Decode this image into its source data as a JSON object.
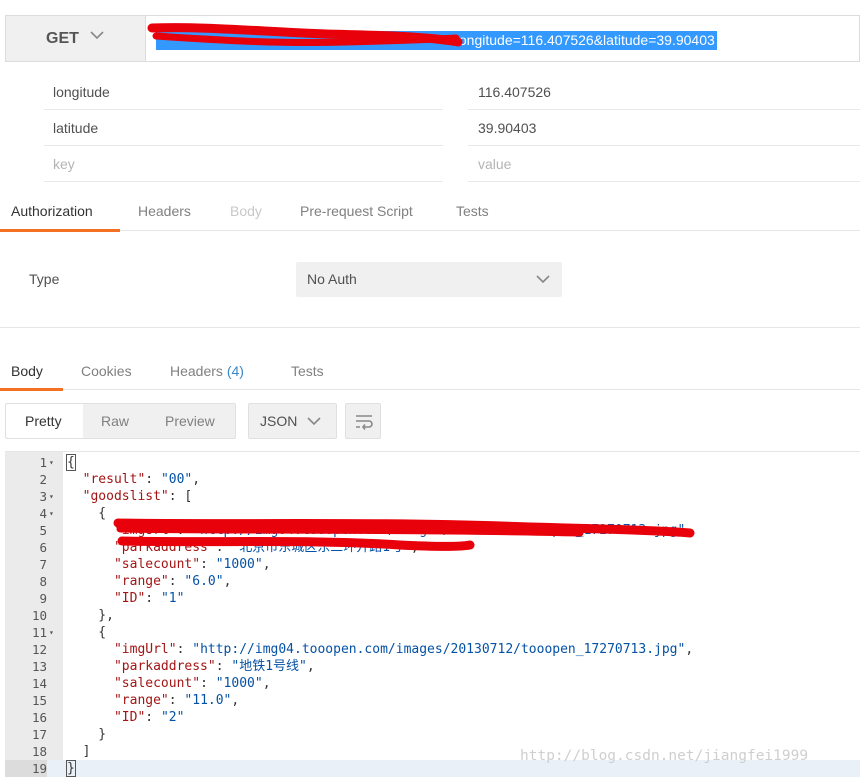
{
  "request": {
    "method": "GET",
    "url_visible_part": "?longitude=116.407526&latitude=39.90403"
  },
  "params": [
    {
      "key": "longitude",
      "value": "116.407526"
    },
    {
      "key": "latitude",
      "value": "39.90403"
    }
  ],
  "params_placeholder": {
    "key": "key",
    "value": "value"
  },
  "request_tabs": [
    "Authorization",
    "Headers",
    "Body",
    "Pre-request Script",
    "Tests"
  ],
  "auth": {
    "type_label": "Type",
    "type_value": "No Auth"
  },
  "response_tabs": {
    "body": "Body",
    "cookies": "Cookies",
    "headers": "Headers",
    "headers_count": "(4)",
    "tests": "Tests"
  },
  "view": {
    "pretty": "Pretty",
    "raw": "Raw",
    "preview": "Preview",
    "format": "JSON"
  },
  "response_json": {
    "result": "00",
    "goodslist": [
      {
        "imgUrl": "http://img04.tooopen.com/images/20130712/tooopen_17270713.jpg",
        "parkaddress": "北京...",
        "salecount": "1000",
        "range": "6.0",
        "ID": "1"
      },
      {
        "imgUrl": "http://img04.tooopen.com/images/20130712/tooopen_17270713.jpg",
        "parkaddress": "地铁1号线",
        "salecount": "1000",
        "range": "11.0",
        "ID": "2"
      }
    ]
  },
  "code_lines": [
    {
      "n": "1",
      "fold": true,
      "t": "{"
    },
    {
      "n": "2",
      "fold": false,
      "t": "  \"result\": \"00\","
    },
    {
      "n": "3",
      "fold": true,
      "t": "  \"goodslist\": ["
    },
    {
      "n": "4",
      "fold": true,
      "t": "    {"
    },
    {
      "n": "5",
      "fold": false,
      "t": "      \"imgUrl\": \"http://img04.tooopen.com/images/20130712/tooopen_17270713.jpg\","
    },
    {
      "n": "6",
      "fold": false,
      "t": "      \"parkaddress\": \"北京市东城区东三环开路1号\","
    },
    {
      "n": "7",
      "fold": false,
      "t": "      \"salecount\": \"1000\","
    },
    {
      "n": "8",
      "fold": false,
      "t": "      \"range\": \"6.0\","
    },
    {
      "n": "9",
      "fold": false,
      "t": "      \"ID\": \"1\""
    },
    {
      "n": "10",
      "fold": false,
      "t": "    },"
    },
    {
      "n": "11",
      "fold": true,
      "t": "    {"
    },
    {
      "n": "12",
      "fold": false,
      "t": "      \"imgUrl\": \"http://img04.tooopen.com/images/20130712/tooopen_17270713.jpg\","
    },
    {
      "n": "13",
      "fold": false,
      "t": "      \"parkaddress\": \"地铁1号线\","
    },
    {
      "n": "14",
      "fold": false,
      "t": "      \"salecount\": \"1000\","
    },
    {
      "n": "15",
      "fold": false,
      "t": "      \"range\": \"11.0\","
    },
    {
      "n": "16",
      "fold": false,
      "t": "      \"ID\": \"2\""
    },
    {
      "n": "17",
      "fold": false,
      "t": "    }"
    },
    {
      "n": "18",
      "fold": false,
      "t": "  ]"
    },
    {
      "n": "19",
      "fold": false,
      "t": "}"
    }
  ],
  "watermark": "http://blog.csdn.net/jiangfei1999",
  "colors": {
    "accent": "#f47023",
    "selection": "#3399ff",
    "count": "#3a87c8",
    "redact": "#e8000b"
  }
}
